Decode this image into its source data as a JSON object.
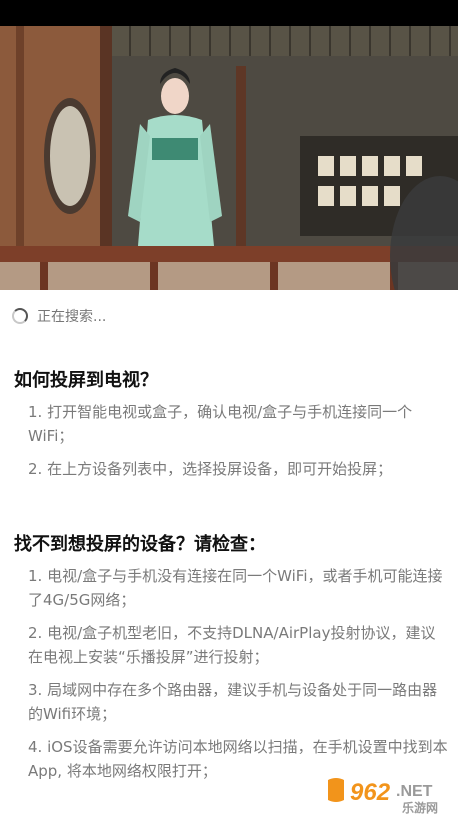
{
  "video": {
    "description_icon": "video-preview"
  },
  "status": {
    "searching_text": "正在搜索..."
  },
  "section1": {
    "title": "如何投屏到电视？",
    "items": [
      "1. 打开智能电视或盒子，确认电视/盒子与手机连接同一个WiFi；",
      "2. 在上方设备列表中，选择投屏设备，即可开始投屏；"
    ]
  },
  "section2": {
    "title": "找不到想投屏的设备？请检查：",
    "items": [
      "1. 电视/盒子与手机没有连接在同一个WiFi，或者手机可能连接了4G/5G网络；",
      "2. 电视/盒子机型老旧，不支持DLNA/AirPlay投射协议，建议在电视上安装“乐播投屏”进行投射；",
      "3. 局域网中存在多个路由器，建议手机与设备处于同一路由器的Wifi环境；",
      "4. iOS设备需要允许访问本地网络以扫描，在手机设置中找到本App, 将本地网络权限打开；"
    ]
  },
  "watermark": {
    "number": "962",
    "suffix": ".NET",
    "site": "乐游网"
  },
  "colors": {
    "accent": "#2a7fd6",
    "watermark_orange": "#f2941b"
  }
}
